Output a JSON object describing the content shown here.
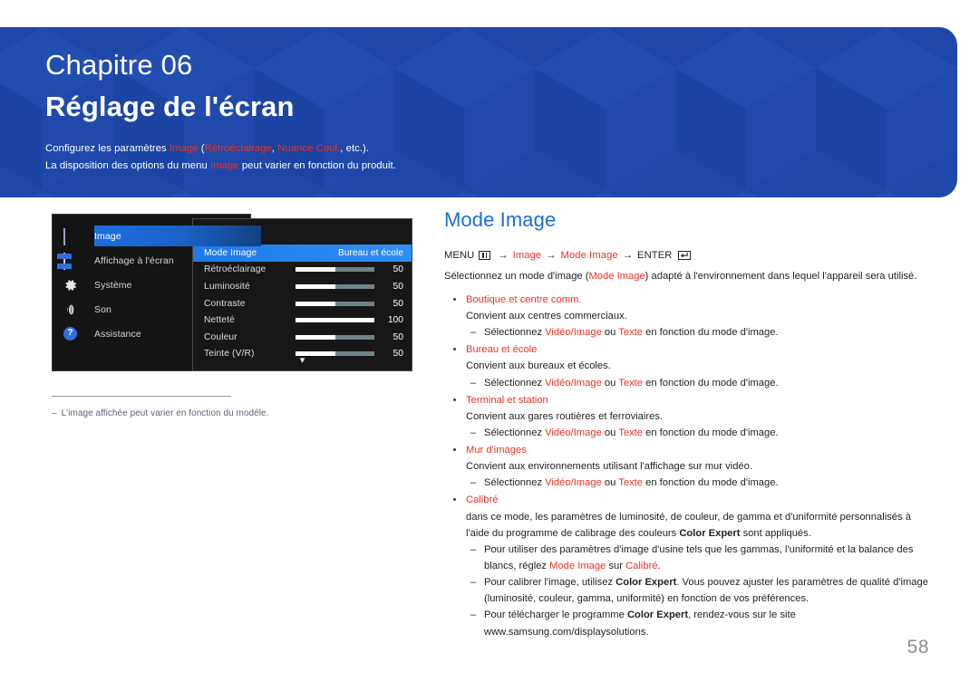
{
  "banner": {
    "chapter_label": "Chapitre 06",
    "chapter_title": "Réglage de l'écran",
    "note_line1_parts": [
      {
        "t": "Configurez les paramètres ",
        "c": "white"
      },
      {
        "t": "Image",
        "c": "accent"
      },
      {
        "t": " (",
        "c": "white"
      },
      {
        "t": "Rétroéclairage",
        "c": "accent"
      },
      {
        "t": ", ",
        "c": "white"
      },
      {
        "t": "Nuance Coul.",
        "c": "accent"
      },
      {
        "t": ", etc.).",
        "c": "white"
      }
    ],
    "note_line2_parts": [
      {
        "t": "La disposition des options du menu ",
        "c": "white"
      },
      {
        "t": "Image",
        "c": "accent"
      },
      {
        "t": " peut varier en fonction du produit.",
        "c": "white"
      }
    ],
    "bg_color": "#1e47a8",
    "accent_color": "#ea3323"
  },
  "osd": {
    "nav_items": [
      {
        "label": "Image",
        "icon": "picture-icon",
        "active": true
      },
      {
        "label": "Affichage à l'écran",
        "icon": "osd-layout-icon",
        "active": false
      },
      {
        "label": "Système",
        "icon": "gear-icon",
        "active": false
      },
      {
        "label": "Son",
        "icon": "sound-icon",
        "active": false
      },
      {
        "label": "Assistance",
        "icon": "help-circle-icon",
        "active": false
      }
    ],
    "panel_title": "Image",
    "rows": [
      {
        "label": "Mode Image",
        "value": "Bureau et école",
        "type": "value",
        "selected": true
      },
      {
        "label": "Rétroéclairage",
        "value": "50",
        "type": "slider",
        "fill": 50,
        "selected": false
      },
      {
        "label": "Luminosité",
        "value": "50",
        "type": "slider",
        "fill": 50,
        "selected": false
      },
      {
        "label": "Contraste",
        "value": "50",
        "type": "slider",
        "fill": 50,
        "selected": false
      },
      {
        "label": "Netteté",
        "value": "100",
        "type": "slider",
        "fill": 100,
        "selected": false
      },
      {
        "label": "Couleur",
        "value": "50",
        "type": "slider",
        "fill": 50,
        "selected": false
      },
      {
        "label": "Teinte (V/R)",
        "value": "50",
        "type": "slider",
        "fill": 50,
        "selected": false
      }
    ],
    "more_indicator": "chevron-down-icon",
    "footnote": "L'image affichée peut varier en fonction du modèle.",
    "footnote_dash": "–"
  },
  "article": {
    "title": "Mode Image",
    "menu_path": {
      "menu_label": "MENU",
      "menu_icon": "menu-grid-icon",
      "arrow": "→",
      "step1": "Image",
      "step2": "Mode Image",
      "enter_label": "ENTER",
      "enter_icon": "enter-key-icon"
    },
    "lead_parts": [
      {
        "t": "Sélectionnez un mode d'image (",
        "c": "normal"
      },
      {
        "t": "Mode Image",
        "c": "accent"
      },
      {
        "t": ") adapté à l'environnement dans lequel l'appareil sera utilisé.",
        "c": "normal"
      }
    ],
    "bullets": [
      {
        "head": "Boutique et centre comm.",
        "desc_parts": [
          {
            "t": "Convient aux centres commerciaux.",
            "c": "normal"
          }
        ],
        "subs": [
          [
            {
              "t": "Sélectionnez ",
              "c": "normal"
            },
            {
              "t": "Vidéo/Image",
              "c": "accent"
            },
            {
              "t": " ou ",
              "c": "normal"
            },
            {
              "t": "Texte",
              "c": "accent"
            },
            {
              "t": " en fonction du mode d'image.",
              "c": "normal"
            }
          ]
        ]
      },
      {
        "head": "Bureau et école",
        "desc_parts": [
          {
            "t": "Convient aux bureaux et écoles.",
            "c": "normal"
          }
        ],
        "subs": [
          [
            {
              "t": "Sélectionnez ",
              "c": "normal"
            },
            {
              "t": "Vidéo/Image",
              "c": "accent"
            },
            {
              "t": " ou ",
              "c": "normal"
            },
            {
              "t": "Texte",
              "c": "accent"
            },
            {
              "t": " en fonction du mode d'image.",
              "c": "normal"
            }
          ]
        ]
      },
      {
        "head": "Terminal et station",
        "desc_parts": [
          {
            "t": "Convient aux gares routières et ferroviaires.",
            "c": "normal"
          }
        ],
        "subs": [
          [
            {
              "t": "Sélectionnez ",
              "c": "normal"
            },
            {
              "t": "Vidéo/Image",
              "c": "accent"
            },
            {
              "t": " ou ",
              "c": "normal"
            },
            {
              "t": "Texte",
              "c": "accent"
            },
            {
              "t": " en fonction du mode d'image.",
              "c": "normal"
            }
          ]
        ]
      },
      {
        "head": "Mur d'images",
        "desc_parts": [
          {
            "t": "Convient aux environnements utilisant l'affichage sur mur vidéo.",
            "c": "normal"
          }
        ],
        "subs": [
          [
            {
              "t": "Sélectionnez ",
              "c": "normal"
            },
            {
              "t": "Vidéo/Image",
              "c": "accent"
            },
            {
              "t": " ou ",
              "c": "normal"
            },
            {
              "t": "Texte",
              "c": "accent"
            },
            {
              "t": " en fonction du mode d'image.",
              "c": "normal"
            }
          ]
        ]
      },
      {
        "head": "Calibré",
        "desc_parts": [
          {
            "t": "dans ce mode, les paramètres de luminosité, de couleur, de gamma et d'uniformité personnalisés à l'aide du programme de calibrage des couleurs ",
            "c": "normal"
          },
          {
            "t": "Color Expert",
            "c": "bold"
          },
          {
            "t": " sont appliqués.",
            "c": "normal"
          }
        ],
        "subs": [
          [
            {
              "t": "Pour utiliser des paramètres d'image d'usine tels que les gammas, l'uniformité et la balance des blancs, réglez ",
              "c": "normal"
            },
            {
              "t": "Mode Image",
              "c": "accent"
            },
            {
              "t": " sur ",
              "c": "normal"
            },
            {
              "t": "Calibré",
              "c": "accent"
            },
            {
              "t": ".",
              "c": "normal"
            }
          ],
          [
            {
              "t": "Pour calibrer l'image, utilisez ",
              "c": "normal"
            },
            {
              "t": "Color Expert",
              "c": "bold"
            },
            {
              "t": ". Vous pouvez ajuster les paramètres de qualité d'image (luminosité, couleur, gamma, uniformité) en fonction de vos préférences.",
              "c": "normal"
            }
          ],
          [
            {
              "t": "Pour télécharger le programme ",
              "c": "normal"
            },
            {
              "t": "Color Expert",
              "c": "bold"
            },
            {
              "t": ", rendez-vous sur le site www.samsung.com/displaysolutions.",
              "c": "normal"
            }
          ]
        ]
      }
    ]
  },
  "page_number": "58"
}
